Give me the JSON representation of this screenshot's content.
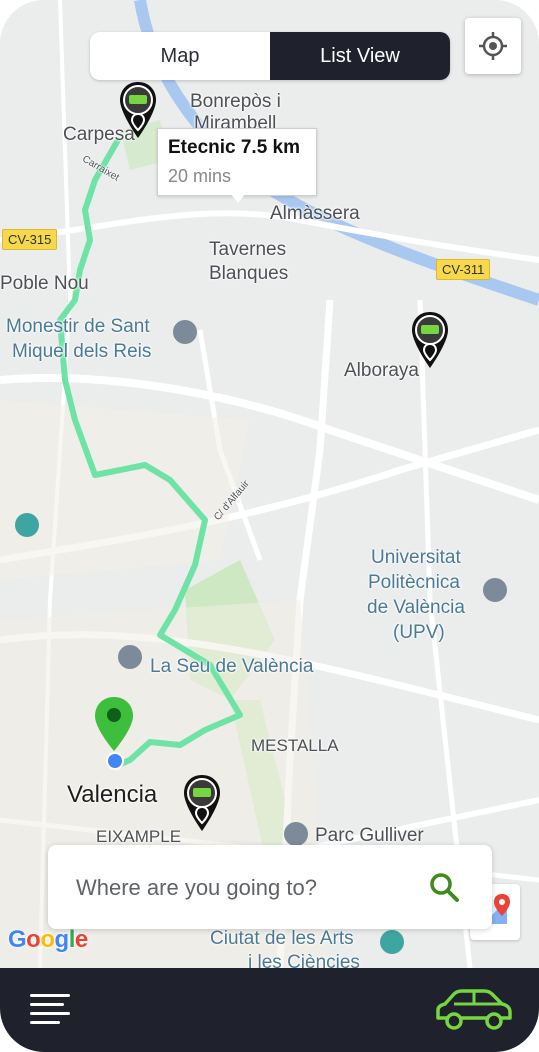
{
  "toggle": {
    "map_label": "Map",
    "list_label": "List View",
    "active": "list"
  },
  "tooltip": {
    "title": "Etecnic 7.5 km",
    "subtitle": "20 mins"
  },
  "map_labels": {
    "bonrepos": "Bonrepòs i",
    "mirambell": "Mirambell",
    "carpesa": "Carpesa",
    "almassera": "Almàssera",
    "tavernes": "Tavernes",
    "blanques": "Blanques",
    "poble_nou": "Poble Nou",
    "monestir1": "Monestir de Sant",
    "monestir2": "Miquel dels Reis",
    "alboraya": "Alboraya",
    "universitat1": "Universitat",
    "universitat2": "Politècnica",
    "universitat3": "de València",
    "universitat4": "(UPV)",
    "la_seu": "La Seu de València",
    "mestalla": "MESTALLA",
    "valencia": "Valencia",
    "eixample": "EIXAMPLE",
    "parc_gulliver": "Parc Gulliver",
    "ciutat1": "Ciutat de les Arts",
    "ciutat2": "i les Ciències",
    "cv315": "CV-315",
    "cv311": "CV-311",
    "carraixet": "Carraixet",
    "alfauir": "C/ d'Alfauir"
  },
  "search": {
    "placeholder": "Where are you going to?"
  },
  "google_logo": "Google",
  "colors": {
    "route": "#6fe3a6",
    "accent_green": "#76d63f",
    "dark_bar": "#1f222d",
    "pin_green": "#3dbf3d",
    "user_dot": "#4285f4"
  },
  "icons": [
    "locate-icon",
    "search-icon",
    "menu-icon",
    "car-icon",
    "charger-pin-icon",
    "destination-pin-icon",
    "google-maps-icon"
  ]
}
